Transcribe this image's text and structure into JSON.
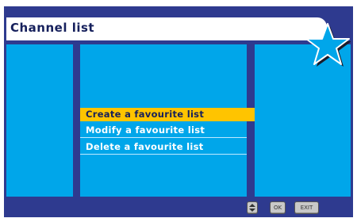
{
  "header": {
    "title": "Channel list"
  },
  "menu": {
    "items": [
      {
        "label": "Create a favourite list",
        "selected": true
      },
      {
        "label": "Modify a favourite list",
        "selected": false
      },
      {
        "label": "Delete a favourite list",
        "selected": false
      }
    ]
  },
  "footer": {
    "ok_label": "OK",
    "exit_label": "EXIT"
  },
  "colors": {
    "frame": "#2e3a8f",
    "panel": "#00a6ea",
    "highlight": "#ffc400",
    "star": "#00a6ea"
  },
  "icons": {
    "nav": "up-down-arrows-icon",
    "logo": "star-icon"
  }
}
